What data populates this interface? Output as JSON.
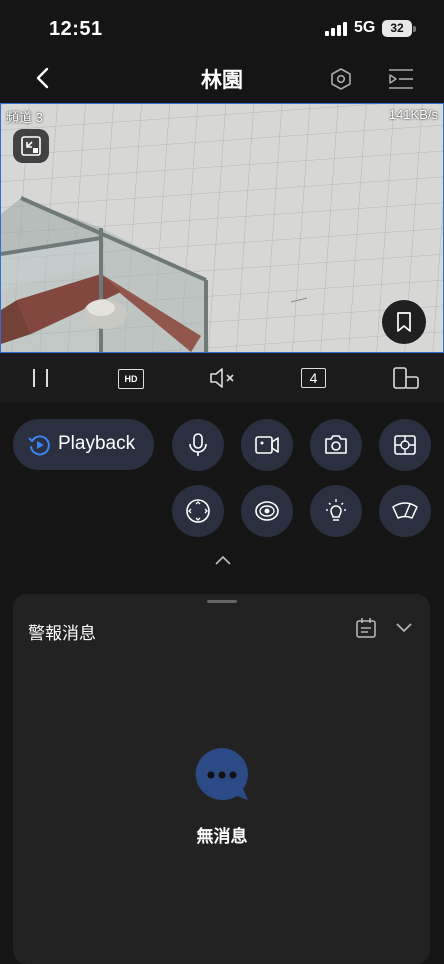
{
  "status": {
    "time": "12:51",
    "network": "5G",
    "battery": "32"
  },
  "header": {
    "title": "林園"
  },
  "video": {
    "channel": "頻道 3",
    "bitrate": "141KB/s"
  },
  "controls": {
    "quality": "HD",
    "split": "4"
  },
  "actions": {
    "playback_label": "Playback"
  },
  "alarm": {
    "title": "警報消息",
    "empty_text": "無消息"
  },
  "colors": {
    "accent": "#2e6fcf",
    "button_bg": "#2a3040",
    "panel_bg": "#222222"
  }
}
